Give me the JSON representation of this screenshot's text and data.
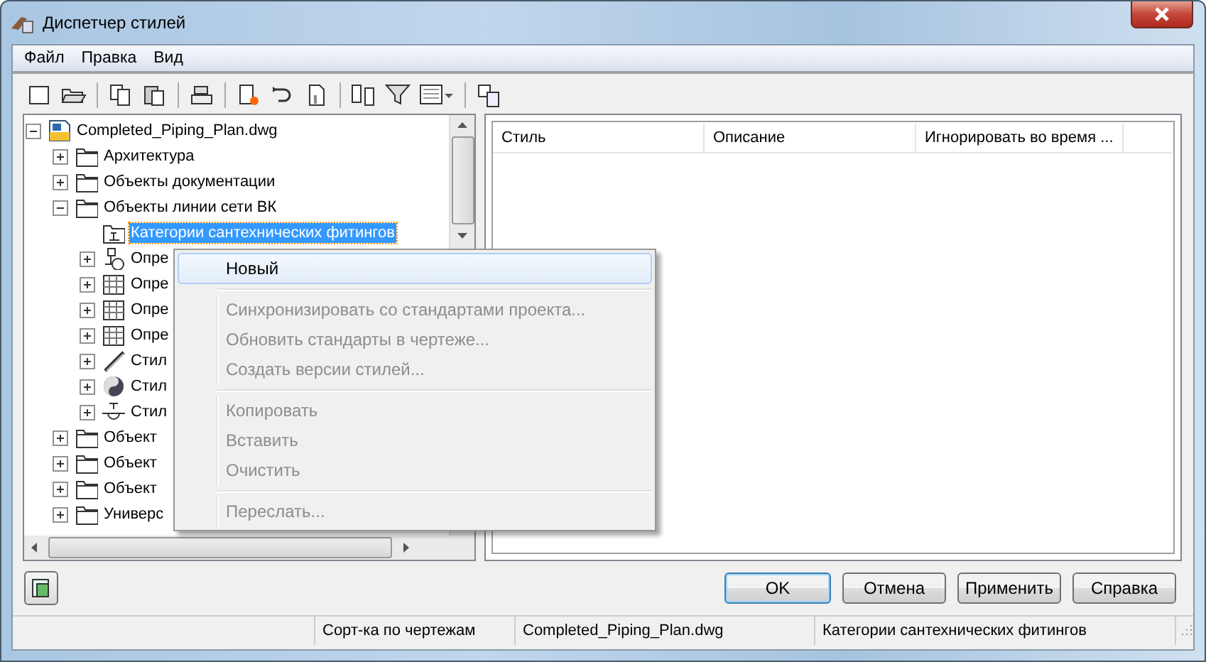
{
  "window": {
    "title": "Диспетчер стилей"
  },
  "menu_bar": [
    "Файл",
    "Правка",
    "Вид"
  ],
  "toolbar": [
    {
      "kind": "new"
    },
    {
      "kind": "open"
    },
    {
      "kind": "sep"
    },
    {
      "kind": "copy"
    },
    {
      "kind": "paste"
    },
    {
      "kind": "sep"
    },
    {
      "kind": "stamp"
    },
    {
      "kind": "sep"
    },
    {
      "kind": "newstyle"
    },
    {
      "kind": "loop"
    },
    {
      "kind": "clean"
    },
    {
      "kind": "sep"
    },
    {
      "kind": "compare"
    },
    {
      "kind": "filter"
    },
    {
      "kind": "view"
    },
    {
      "kind": "sep"
    },
    {
      "kind": "transfer"
    }
  ],
  "tree": {
    "label": "Completed_Piping_Plan.dwg",
    "kind": "drawing",
    "expanded": true,
    "selected": false,
    "children": [
      {
        "label": "Архитектура",
        "kind": "folder",
        "expanded": false,
        "selected": false
      },
      {
        "label": "Объекты документации",
        "kind": "folder",
        "expanded": false,
        "selected": false
      },
      {
        "label": "Объекты линии сети ВК",
        "kind": "folder",
        "expanded": true,
        "selected": false,
        "children": [
          {
            "label": "Категории сантехнических фитингов",
            "kind": "fittings",
            "selected": true
          },
          {
            "label": "Опре",
            "kind": "flow",
            "expanded": false,
            "selected": false
          },
          {
            "label": "Опре",
            "kind": "table",
            "expanded": false,
            "selected": false
          },
          {
            "label": "Опре",
            "kind": "table",
            "expanded": false,
            "selected": false
          },
          {
            "label": "Опре",
            "kind": "table",
            "expanded": false,
            "selected": false
          },
          {
            "label": "Стил",
            "kind": "pipe",
            "expanded": false,
            "selected": false
          },
          {
            "label": "Стил",
            "kind": "disc",
            "expanded": false,
            "selected": false
          },
          {
            "label": "Стил",
            "kind": "valve",
            "expanded": false,
            "selected": false
          }
        ]
      },
      {
        "label": "Объект",
        "kind": "folder",
        "expanded": false,
        "selected": false
      },
      {
        "label": "Объект",
        "kind": "folder",
        "expanded": false,
        "selected": false
      },
      {
        "label": "Объект",
        "kind": "folder",
        "expanded": false,
        "selected": false
      },
      {
        "label": "Универс",
        "kind": "folder",
        "expanded": false,
        "selected": false
      }
    ]
  },
  "table": {
    "columns": [
      "Стиль",
      "Описание",
      "Игнорировать во время ..."
    ]
  },
  "context_menu": {
    "groups": [
      [
        {
          "label": "Новый",
          "disabled": false,
          "selected": true
        }
      ],
      [
        {
          "label": "Синхронизировать со стандартами проекта...",
          "disabled": true,
          "selected": false
        },
        {
          "label": "Обновить стандарты в чертеже...",
          "disabled": true,
          "selected": false
        },
        {
          "label": "Создать версии стилей...",
          "disabled": true,
          "selected": false
        }
      ],
      [
        {
          "label": "Копировать",
          "disabled": true,
          "selected": false
        },
        {
          "label": "Вставить",
          "disabled": true,
          "selected": false
        },
        {
          "label": "Очистить",
          "disabled": true,
          "selected": false
        }
      ],
      [
        {
          "label": "Переслать...",
          "disabled": true,
          "selected": false
        }
      ]
    ]
  },
  "buttons": [
    {
      "label": "OK",
      "default": true
    },
    {
      "label": "Отмена",
      "default": false
    },
    {
      "label": "Применить",
      "default": false
    },
    {
      "label": "Справка",
      "default": false
    }
  ],
  "status_bar": [
    "Сорт-ка по чертежам",
    "Completed_Piping_Plan.dwg",
    "Категории сантехнических фитингов"
  ]
}
